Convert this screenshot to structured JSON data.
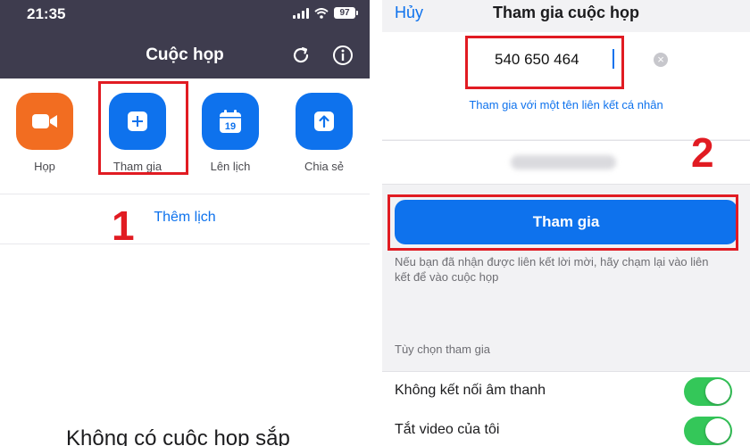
{
  "left": {
    "status": {
      "time": "21:35",
      "battery": "97"
    },
    "title": "Cuộc họp",
    "icons": {
      "refresh": "refresh-icon",
      "info": "info-icon"
    },
    "actions": [
      {
        "label": "Họp",
        "icon": "video-camera-icon",
        "color": "#f26d21"
      },
      {
        "label": "Tham gia",
        "icon": "plus-icon",
        "color": "#0e72ed"
      },
      {
        "label": "Lên lịch",
        "icon": "calendar-icon",
        "color": "#0e72ed",
        "calendar_day": "19"
      },
      {
        "label": "Chia sẻ",
        "icon": "share-arrow-icon",
        "color": "#0e72ed"
      }
    ],
    "add_calendar": "Thêm lịch",
    "step": "1",
    "empty_state": "Không có cuộc họp sắp"
  },
  "right": {
    "cancel": "Hủy",
    "title": "Tham gia cuộc họp",
    "meeting_id": "540 650 464",
    "personal_link": "Tham gia với một tên liên kết cá nhân",
    "step": "2",
    "join_button": "Tham gia",
    "hint": "Nếu bạn đã nhận được liên kết lời mời, hãy chạm lại vào liên kết để vào cuộc họp",
    "options_header": "Tùy chọn tham gia",
    "options": [
      {
        "label": "Không kết nối âm thanh",
        "enabled": true
      },
      {
        "label": "Tắt video của tôi",
        "enabled": true
      }
    ]
  },
  "colors": {
    "accent": "#0e72ed",
    "orange": "#f26d21",
    "highlight": "#e11b22",
    "header": "#3e3c4e",
    "toggle_on": "#34c759"
  }
}
